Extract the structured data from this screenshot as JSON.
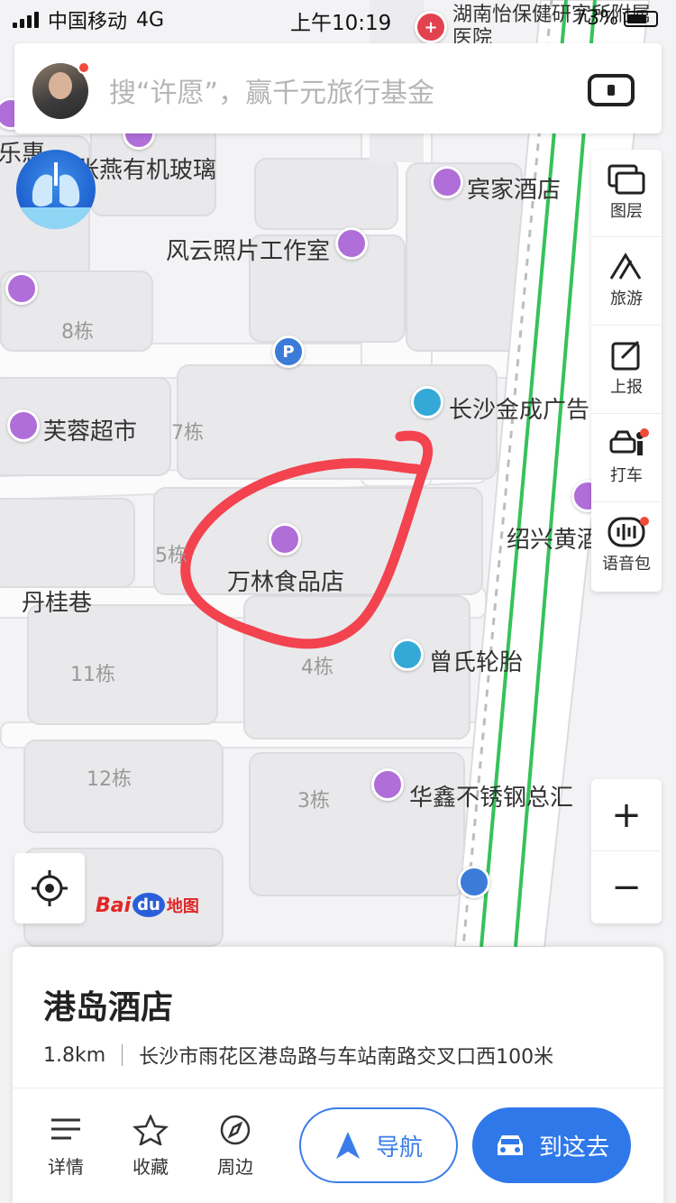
{
  "status_bar": {
    "carrier": "中国移动",
    "network": "4G",
    "time": "上午10:19",
    "battery": "73%"
  },
  "search": {
    "placeholder": "搜“许愿”，赢千元旅行基金"
  },
  "tools": [
    {
      "label": "图层",
      "icon": "layers-icon"
    },
    {
      "label": "旅游",
      "icon": "travel-icon"
    },
    {
      "label": "上报",
      "icon": "report-icon"
    },
    {
      "label": "打车",
      "icon": "taxi-icon"
    },
    {
      "label": "语音包",
      "icon": "voice-pack-icon"
    }
  ],
  "zoom": {
    "plus": "+",
    "minus": "−"
  },
  "map": {
    "pois": {
      "hospital": "湖南怡保健研究所附属医院",
      "glass": "张燕有机玻璃",
      "lehui": "乐惠",
      "hotel": "宾家酒店",
      "photo": "风云照片工作室",
      "furong": "芙蓉超市",
      "jincheng": "长沙金成广告",
      "wanlin": "万林食品店",
      "shaoxing": "绍兴黄酒",
      "tire": "曾氏轮胎",
      "steel": "华鑫不锈钢总汇",
      "street": "丹桂巷"
    },
    "buildings": {
      "b8": "8栋",
      "b7": "7栋",
      "b5": "5栋",
      "b4": "4栋",
      "b11": "11栋",
      "b12": "12栋",
      "b3": "3栋",
      "b8b": "8栋"
    },
    "parking": "P"
  },
  "logo": {
    "bai": "Bai",
    "du": "du",
    "map": "地图"
  },
  "card": {
    "title": "港岛酒店",
    "distance": "1.8km",
    "address": "长沙市雨花区港岛路与车站南路交叉口西100米",
    "actions": {
      "details": "详情",
      "favorite": "收藏",
      "nearby": "周边"
    },
    "navigate": "导航",
    "go": "到这去"
  },
  "colors": {
    "accent": "#2f78ea",
    "poi": "#b06ed9",
    "annotation": "#f2434f",
    "rail": "#36c25a"
  }
}
